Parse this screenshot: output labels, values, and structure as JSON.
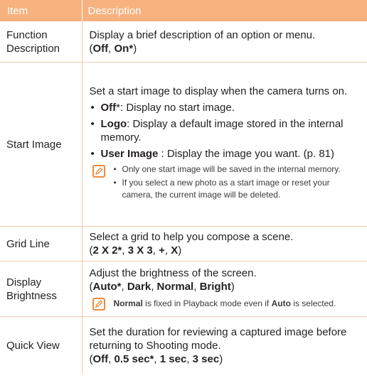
{
  "header": {
    "item": "Item",
    "description": "Description"
  },
  "rows": [
    {
      "item": "Function Description",
      "desc_text": "Display a brief description of an option or menu.",
      "opts": [
        "Off",
        "On*"
      ]
    },
    {
      "item": "Start Image",
      "desc_text": "Set a start image to display when the camera turns on.",
      "bullets": [
        {
          "label": "Off",
          "suffix": "*",
          "text": ": Display no start image."
        },
        {
          "label": "Logo",
          "text": ": Display a default image stored in the internal memory."
        },
        {
          "label": "User Image",
          "text": " : Display the image you want. (p. 81)"
        }
      ],
      "notes": [
        "Only one start image will be saved in the internal memory.",
        "If you select a new photo as a start image or reset your camera, the current image will be deleted."
      ]
    },
    {
      "item": "Grid Line",
      "desc_text": "Select a grid to help you compose a scene.",
      "opts": [
        "2 X 2*",
        "3 X 3",
        "+",
        "X"
      ]
    },
    {
      "item": "Display Brightness",
      "desc_text": "Adjust the brightness of the screen.",
      "opts": [
        "Auto*",
        "Dark",
        "Normal",
        "Bright"
      ],
      "note": {
        "b1": "Normal",
        "t1": " is fixed in Playback mode even if ",
        "b2": "Auto",
        "t2": " is selected."
      }
    },
    {
      "item": "Quick View",
      "desc_text": "Set the duration for reviewing a captured image before returning to Shooting mode.",
      "opts": [
        "Off",
        "0.5 sec*",
        "1 sec",
        "3 sec"
      ]
    }
  ]
}
